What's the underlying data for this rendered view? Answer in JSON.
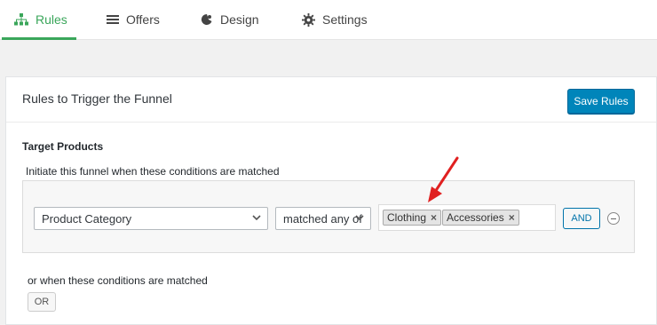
{
  "tabs": [
    {
      "label": "Rules",
      "icon": "sitemap-icon",
      "active": true
    },
    {
      "label": "Offers",
      "icon": "list-icon",
      "active": false
    },
    {
      "label": "Design",
      "icon": "palette-icon",
      "active": false
    },
    {
      "label": "Settings",
      "icon": "gear-icon",
      "active": false
    }
  ],
  "panel": {
    "title": "Rules to Trigger the Funnel",
    "save_label": "Save Rules",
    "section_title": "Target Products",
    "condition_label": "Initiate this funnel when these conditions are matched",
    "rule": {
      "field_value": "Product Category",
      "operator_value": "matched any of",
      "tags": [
        "Clothing",
        "Accessories"
      ],
      "remove_glyph": "×",
      "and_label": "AND"
    },
    "or_condition_label": "or when these conditions are matched",
    "or_label": "OR"
  },
  "colors": {
    "accent_green": "#3aa65a",
    "primary_blue": "#0085ba",
    "link_blue": "#0073aa",
    "annotation_red": "#e02020"
  }
}
